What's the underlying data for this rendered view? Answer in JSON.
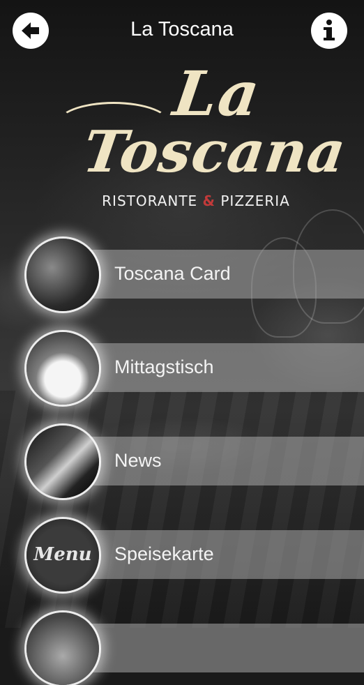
{
  "header": {
    "title": "La Toscana",
    "back_icon": "back-arrow-icon",
    "info_icon": "info-icon"
  },
  "logo": {
    "line1": "La",
    "line2": "Toscana",
    "sub_left": "RISTORANTE",
    "sub_amp": "&",
    "sub_right": "PIZZERIA",
    "logo_color": "#efe4c3",
    "amp_color": "#c23a3a"
  },
  "menu": {
    "items": [
      {
        "label": "Toscana Card",
        "thumb": "card"
      },
      {
        "label": "Mittagstisch",
        "thumb": "lunch"
      },
      {
        "label": "News",
        "thumb": "news"
      },
      {
        "label": "Speisekarte",
        "thumb": "carte",
        "thumb_text": "Menu"
      },
      {
        "label": "",
        "thumb": "more"
      }
    ]
  }
}
